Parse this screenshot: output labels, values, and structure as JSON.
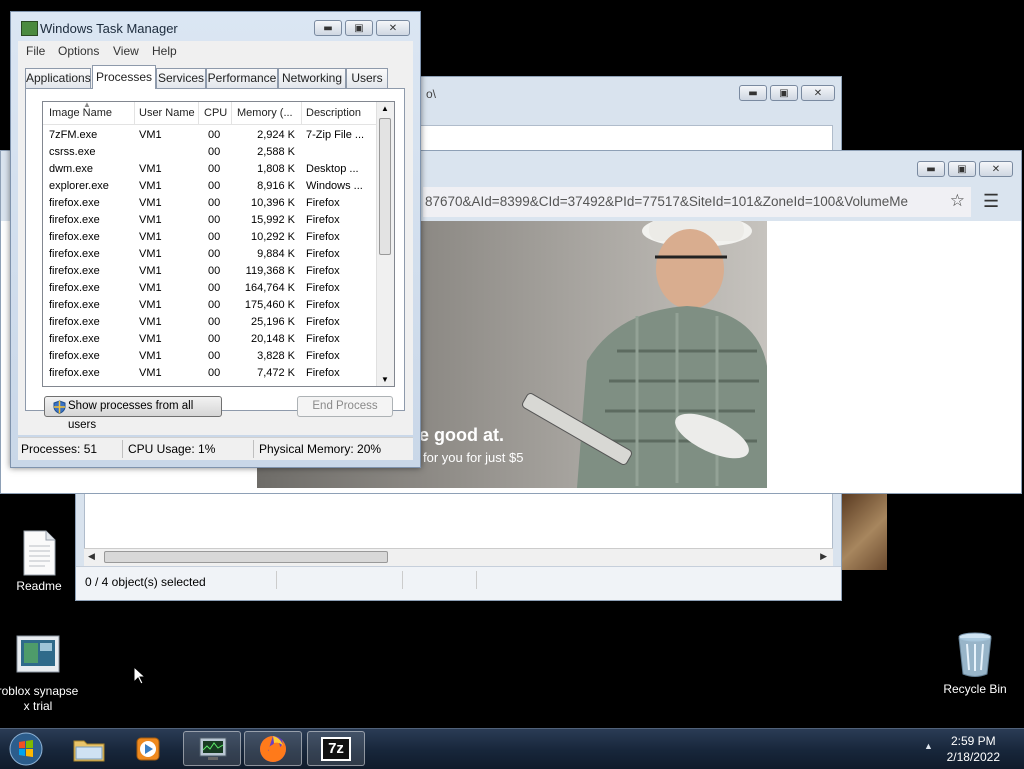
{
  "desktop": {
    "icons": [
      {
        "label": "Readme"
      },
      {
        "label": "roblox synapse x trial"
      },
      {
        "label": "Recycle Bin"
      }
    ]
  },
  "explorer": {
    "title_fragment": "o\\",
    "status": "0 / 4 object(s) selected"
  },
  "browser": {
    "url": "87670&AId=8399&CId=37492&PId=77517&SiteId=101&ZoneId=100&VolumeMe",
    "ad_headline": "e good at.",
    "ad_sub": "for you for just $5"
  },
  "taskmgr": {
    "title": "Windows Task Manager",
    "menu": [
      "File",
      "Options",
      "View",
      "Help"
    ],
    "tabs": [
      "Applications",
      "Processes",
      "Services",
      "Performance",
      "Networking",
      "Users"
    ],
    "active_tab": "Processes",
    "columns": [
      "Image Name",
      "User Name",
      "CPU",
      "Memory (...",
      "Description"
    ],
    "processes": [
      {
        "name": "7zFM.exe",
        "user": "VM1",
        "cpu": "00",
        "mem": "2,924 K",
        "desc": "7-Zip File ..."
      },
      {
        "name": "csrss.exe",
        "user": "",
        "cpu": "00",
        "mem": "2,588 K",
        "desc": ""
      },
      {
        "name": "dwm.exe",
        "user": "VM1",
        "cpu": "00",
        "mem": "1,808 K",
        "desc": "Desktop ..."
      },
      {
        "name": "explorer.exe",
        "user": "VM1",
        "cpu": "00",
        "mem": "8,916 K",
        "desc": "Windows ..."
      },
      {
        "name": "firefox.exe",
        "user": "VM1",
        "cpu": "00",
        "mem": "10,396 K",
        "desc": "Firefox"
      },
      {
        "name": "firefox.exe",
        "user": "VM1",
        "cpu": "00",
        "mem": "15,992 K",
        "desc": "Firefox"
      },
      {
        "name": "firefox.exe",
        "user": "VM1",
        "cpu": "00",
        "mem": "10,292 K",
        "desc": "Firefox"
      },
      {
        "name": "firefox.exe",
        "user": "VM1",
        "cpu": "00",
        "mem": "9,884 K",
        "desc": "Firefox"
      },
      {
        "name": "firefox.exe",
        "user": "VM1",
        "cpu": "00",
        "mem": "119,368 K",
        "desc": "Firefox"
      },
      {
        "name": "firefox.exe",
        "user": "VM1",
        "cpu": "00",
        "mem": "164,764 K",
        "desc": "Firefox"
      },
      {
        "name": "firefox.exe",
        "user": "VM1",
        "cpu": "00",
        "mem": "175,460 K",
        "desc": "Firefox"
      },
      {
        "name": "firefox.exe",
        "user": "VM1",
        "cpu": "00",
        "mem": "25,196 K",
        "desc": "Firefox"
      },
      {
        "name": "firefox.exe",
        "user": "VM1",
        "cpu": "00",
        "mem": "20,148 K",
        "desc": "Firefox"
      },
      {
        "name": "firefox.exe",
        "user": "VM1",
        "cpu": "00",
        "mem": "3,828 K",
        "desc": "Firefox"
      },
      {
        "name": "firefox.exe",
        "user": "VM1",
        "cpu": "00",
        "mem": "7,472 K",
        "desc": "Firefox"
      }
    ],
    "show_all_button": "Show processes from all users",
    "end_process_button": "End Process",
    "status": {
      "processes": "Processes: 51",
      "cpu": "CPU Usage: 1%",
      "memory": "Physical Memory: 20%"
    }
  },
  "taskbar": {
    "time": "2:59 PM",
    "date": "2/18/2022",
    "items": [
      "start-orb-icon",
      "explorer-folder-icon",
      "media-player-icon",
      "task-manager-icon",
      "firefox-icon",
      "7zip-icon"
    ],
    "zip_label": "7z"
  }
}
